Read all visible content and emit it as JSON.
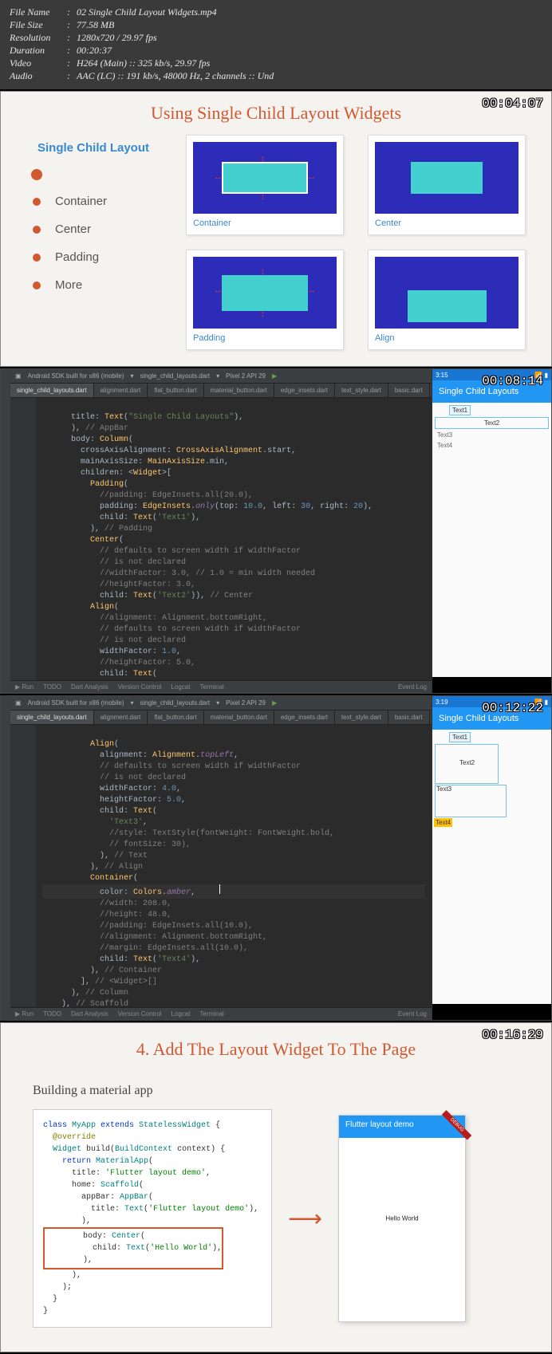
{
  "meta": {
    "filename_label": "File Name",
    "filename": "02 Single Child Layout Widgets.mp4",
    "filesize_label": "File Size",
    "filesize": "77.58 MB",
    "resolution_label": "Resolution",
    "resolution": "1280x720 / 29.97 fps",
    "duration_label": "Duration",
    "duration": "00:20:37",
    "video_label": "Video",
    "video": "H264 (Main) :: 325 kb/s, 29.97 fps",
    "audio_label": "Audio",
    "audio": "AAC (LC) :: 191 kb/s, 48000 Hz, 2 channels :: Und"
  },
  "slide1": {
    "timestamp": "00:04:07",
    "title": "Using Single Child Layout Widgets",
    "nav_title": "Single Child Layout",
    "nav_items": [
      "Container",
      "Center",
      "Padding",
      "More"
    ],
    "boxes": [
      "Container",
      "Center",
      "Padding",
      "Align"
    ]
  },
  "ide1": {
    "timestamp": "00:08:14",
    "toolbar_device": "Android SDK built for x86 (mobile)",
    "toolbar_config": "single_child_layouts.dart",
    "toolbar_device2": "Pixel 2 API 29",
    "tabs": [
      "single_child_layouts.dart",
      "alignment.dart",
      "flat_button.dart",
      "material_button.dart",
      "edge_insets.dart",
      "text_style.dart",
      "basic.dart"
    ],
    "status": [
      "Run",
      "TODO",
      "Dart Analysis",
      "Version Control",
      "Logcat",
      "Terminal"
    ],
    "event_log": "Event Log",
    "emu_time": "3:15",
    "emu_title": "Single Child Layouts",
    "emu_texts": [
      "Text1",
      "Text2",
      "Text3",
      "Text4"
    ]
  },
  "code1": {
    "l1a": "title: ",
    "l1b": "Text",
    "l1c": "(",
    "l1d": "\"Single Child Layouts\"",
    "l1e": "),",
    "l2": "      ), ",
    "l2c": "// AppBar",
    "l3a": "      body: ",
    "l3b": "Column",
    "l3c": "(",
    "l4a": "        crossAxisAlignment: ",
    "l4b": "CrossAxisAlignment",
    "l4c": ".start,",
    "l5a": "        mainAxisSize: ",
    "l5b": "MainAxisSize",
    "l5c": ".min,",
    "l6a": "        children: <",
    "l6b": "Widget",
    "l6c": ">[",
    "l7": "Padding",
    "l7b": "(",
    "l8a": "            ",
    "l8c": "//padding: EdgeInsets.all(20.0),",
    "l9a": "            padding: ",
    "l9b": "EdgeInsets",
    "l9c": ".",
    "l9d": "only",
    "l9e": "(top: ",
    "l9f": "10.0",
    "l9g": ", left: ",
    "l9h": "30",
    "l9i": ", right: ",
    "l9j": "20",
    "l9k": "),",
    "l10a": "            child: ",
    "l10b": "Text",
    "l10c": "(",
    "l10d": "'Text1'",
    "l10e": "),",
    "l11": "          ), ",
    "l11c": "// Padding",
    "l12": "Center",
    "l12b": "(",
    "l13": "            // defaults to screen width if widthFactor",
    "l14": "            // is not declared",
    "l15": "            //widthFactor: 3.0, // 1.0 = min width needed",
    "l16": "            //heightFactor: 3.0,",
    "l17a": "            child: ",
    "l17b": "Text",
    "l17c": "(",
    "l17d": "'Text2'",
    "l17e": ")), ",
    "l17f": "// Center",
    "l18": "Align",
    "l18b": "(",
    "l19": "            //alignment: Alignment.bottomRight,",
    "l20": "            // defaults to screen width if widthFactor",
    "l21": "            // is not declared",
    "l22a": "            widthFactor: ",
    "l22b": "1.0",
    "l22c": ",",
    "l23": "            //heightFactor: 5.0,",
    "l24a": "            child: ",
    "l24b": "Text",
    "l24c": "("
  },
  "ide2": {
    "timestamp": "00:12:22",
    "emu_time": "3:19",
    "emu_title": "Single Child Layouts"
  },
  "code2": {
    "l1": "Align",
    "l1b": "(",
    "l2a": "            alignment: ",
    "l2b": "Alignment",
    "l2c": ".",
    "l2d": "topLeft",
    "l2e": ",",
    "l3": "            // defaults to screen width if widthFactor",
    "l4": "            // is not declared",
    "l5a": "            widthFactor: ",
    "l5b": "4.0",
    "l5c": ",",
    "l6a": "            heightFactor: ",
    "l6b": "5.0",
    "l6c": ",",
    "l7a": "            child: ",
    "l7b": "Text",
    "l7c": "(",
    "l8": "'Text3'",
    "l8b": ",",
    "l9": "              //style: TextStyle(fontWeight: FontWeight.bold,",
    "l10": "              // fontSize: 30),",
    "l11": "            ), ",
    "l11c": "// Text",
    "l12": "          ), ",
    "l12c": "// Align",
    "l13": "Container",
    "l13b": "(",
    "l14a": "            color: ",
    "l14b": "Colors",
    "l14c": ".",
    "l14d": "amber",
    "l14e": ",",
    "l15": "            //width: 208.0,",
    "l16": "            //height: 48.0,",
    "l17": "            //padding: EdgeInsets.all(10.0),",
    "l18": "            //alignment: Alignment.bottomRight,",
    "l19": "            //margin: EdgeInsets.all(10.0),",
    "l20a": "            child: ",
    "l20b": "Text",
    "l20c": "(",
    "l20d": "'Text4'",
    "l20e": "),",
    "l21": "          ), ",
    "l21c": "// Container",
    "l22": "        ], ",
    "l22c": "// <Widget>[]",
    "l23": "      ), ",
    "l23c": "// Column",
    "l24": "    ), ",
    "l24c": "// Scaffold"
  },
  "slide4": {
    "timestamp": "00:16:29",
    "title": "4. Add The Layout Widget To The Page",
    "subtitle": "Building a material app",
    "phone_title": "Flutter layout demo",
    "phone_text": "Hello World",
    "debug": "DEBUG"
  },
  "code4": {
    "l1a": "class ",
    "l1b": "MyApp ",
    "l1c": "extends ",
    "l1d": "StatelessWidget ",
    "l1e": "{",
    "l2": "  @override",
    "l3a": "  ",
    "l3b": "Widget ",
    "l3c": "build(",
    "l3d": "BuildContext ",
    "l3e": "context) {",
    "l4a": "    ",
    "l4b": "return ",
    "l4c": "MaterialApp",
    "l4d": "(",
    "l5a": "      title: ",
    "l5b": "'Flutter layout demo'",
    "l5c": ",",
    "l6a": "      home: ",
    "l6b": "Scaffold",
    "l6c": "(",
    "l7a": "        appBar: ",
    "l7b": "AppBar",
    "l7c": "(",
    "l8a": "          title: ",
    "l8b": "Text",
    "l8c": "(",
    "l8d": "'Flutter layout demo'",
    "l8e": "),",
    "l9": "        ),",
    "l10a": "        body: ",
    "l10b": "Center",
    "l10c": "(",
    "l11a": "          child: ",
    "l11b": "Text",
    "l11c": "(",
    "l11d": "'Hello World'",
    "l11e": "),",
    "l12": "        ),",
    "l13": "      ),",
    "l14": "    );",
    "l15": "  }",
    "l16": "}"
  }
}
